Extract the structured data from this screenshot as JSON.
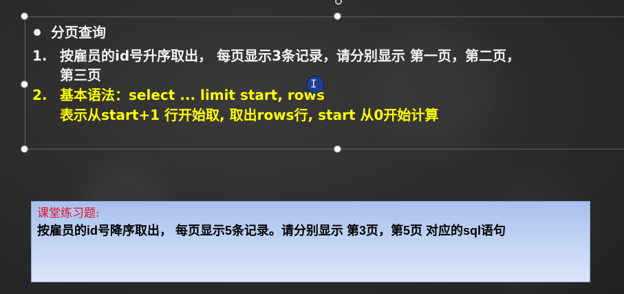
{
  "slide": {
    "heading": "分页查询",
    "item1_number": "1.",
    "item1_line1": "按雇员的id号升序取出， 每页显示3条记录，请分别显示 第一页，第二页，",
    "item1_line2": "第三页",
    "item2_number": "2.",
    "item2_line1": "基本语法：select ... limit start, rows",
    "item2_line2": "表示从start+1 行开始取, 取出rows行, start 从0开始计算"
  },
  "exercise": {
    "title": "课堂练习题:",
    "body": "按雇员的id号降序取出， 每页显示5条记录。请分别显示 第3页，第5页 对应的sql语句"
  },
  "colors": {
    "background": "#2b2b2b",
    "heading_text": "#f2f2f2",
    "highlight_text": "#ffff00",
    "exercise_title": "#e0122a",
    "exercise_box": "#bcd0f2"
  },
  "icons": {
    "rotate": "rotate-handle-icon",
    "cursor": "text-cursor-icon"
  }
}
